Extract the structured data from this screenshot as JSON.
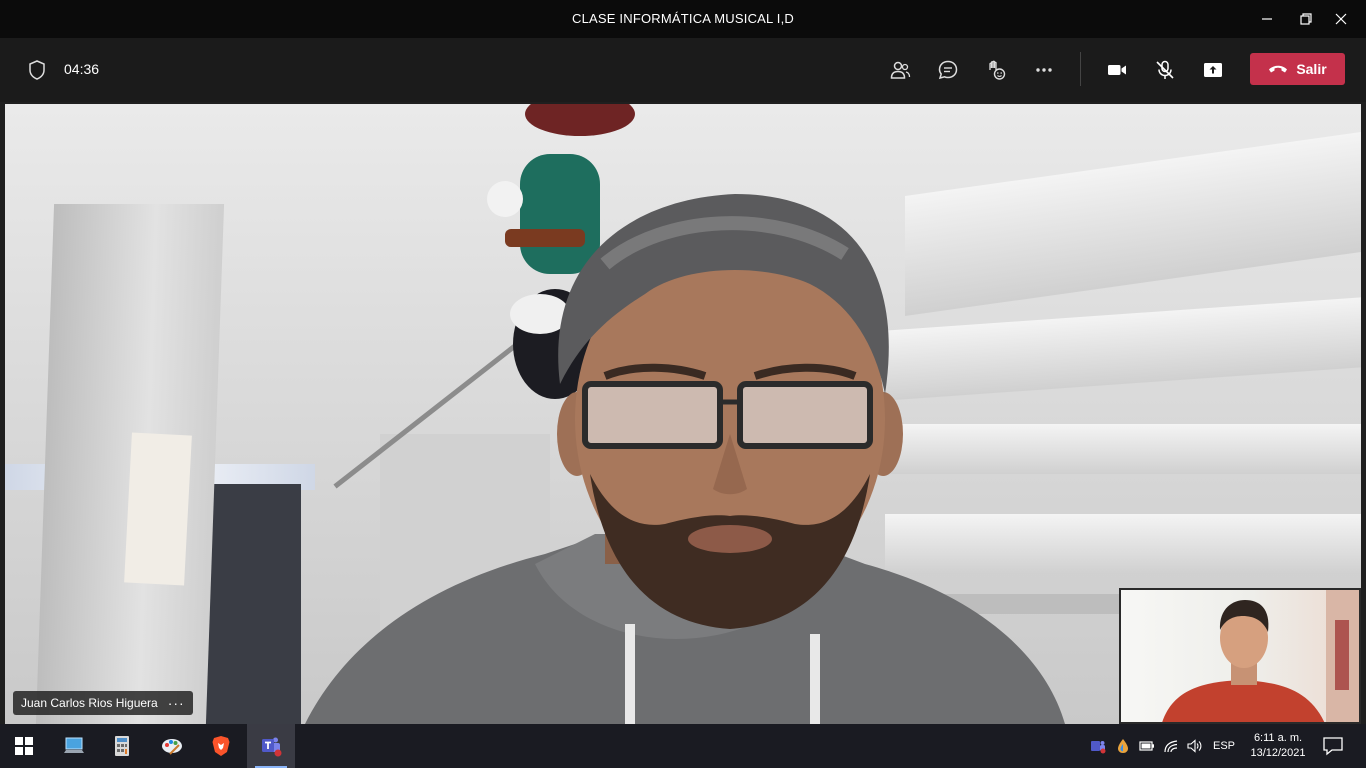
{
  "window": {
    "title": "CLASE INFORMÁTICA MUSICAL I,D",
    "controls": [
      "minimize-icon",
      "restore-icon",
      "close-icon"
    ]
  },
  "meeting_toolbar": {
    "timer": "04:36",
    "buttons": [
      "participants-icon",
      "chat-icon",
      "reactions-icon",
      "more-options-icon",
      "camera-icon",
      "mic-muted-icon",
      "share-screen-icon"
    ],
    "leave_label": "Salir",
    "leave_color": "#c4314b"
  },
  "video": {
    "participant_name": "Juan Carlos Rios Higuera",
    "more_label": "···"
  },
  "taskbar": {
    "apps": [
      "windows-start-icon",
      "this-pc-icon",
      "calculator-icon",
      "paint-icon",
      "brave-icon",
      "teams-icon"
    ],
    "tray_icons": [
      "teams-tray-icon",
      "dropbox-tray-icon",
      "battery-icon",
      "wifi-icon",
      "volume-icon"
    ],
    "language": "ESP",
    "time": "6:11 a. m.",
    "date": "13/12/2021"
  }
}
